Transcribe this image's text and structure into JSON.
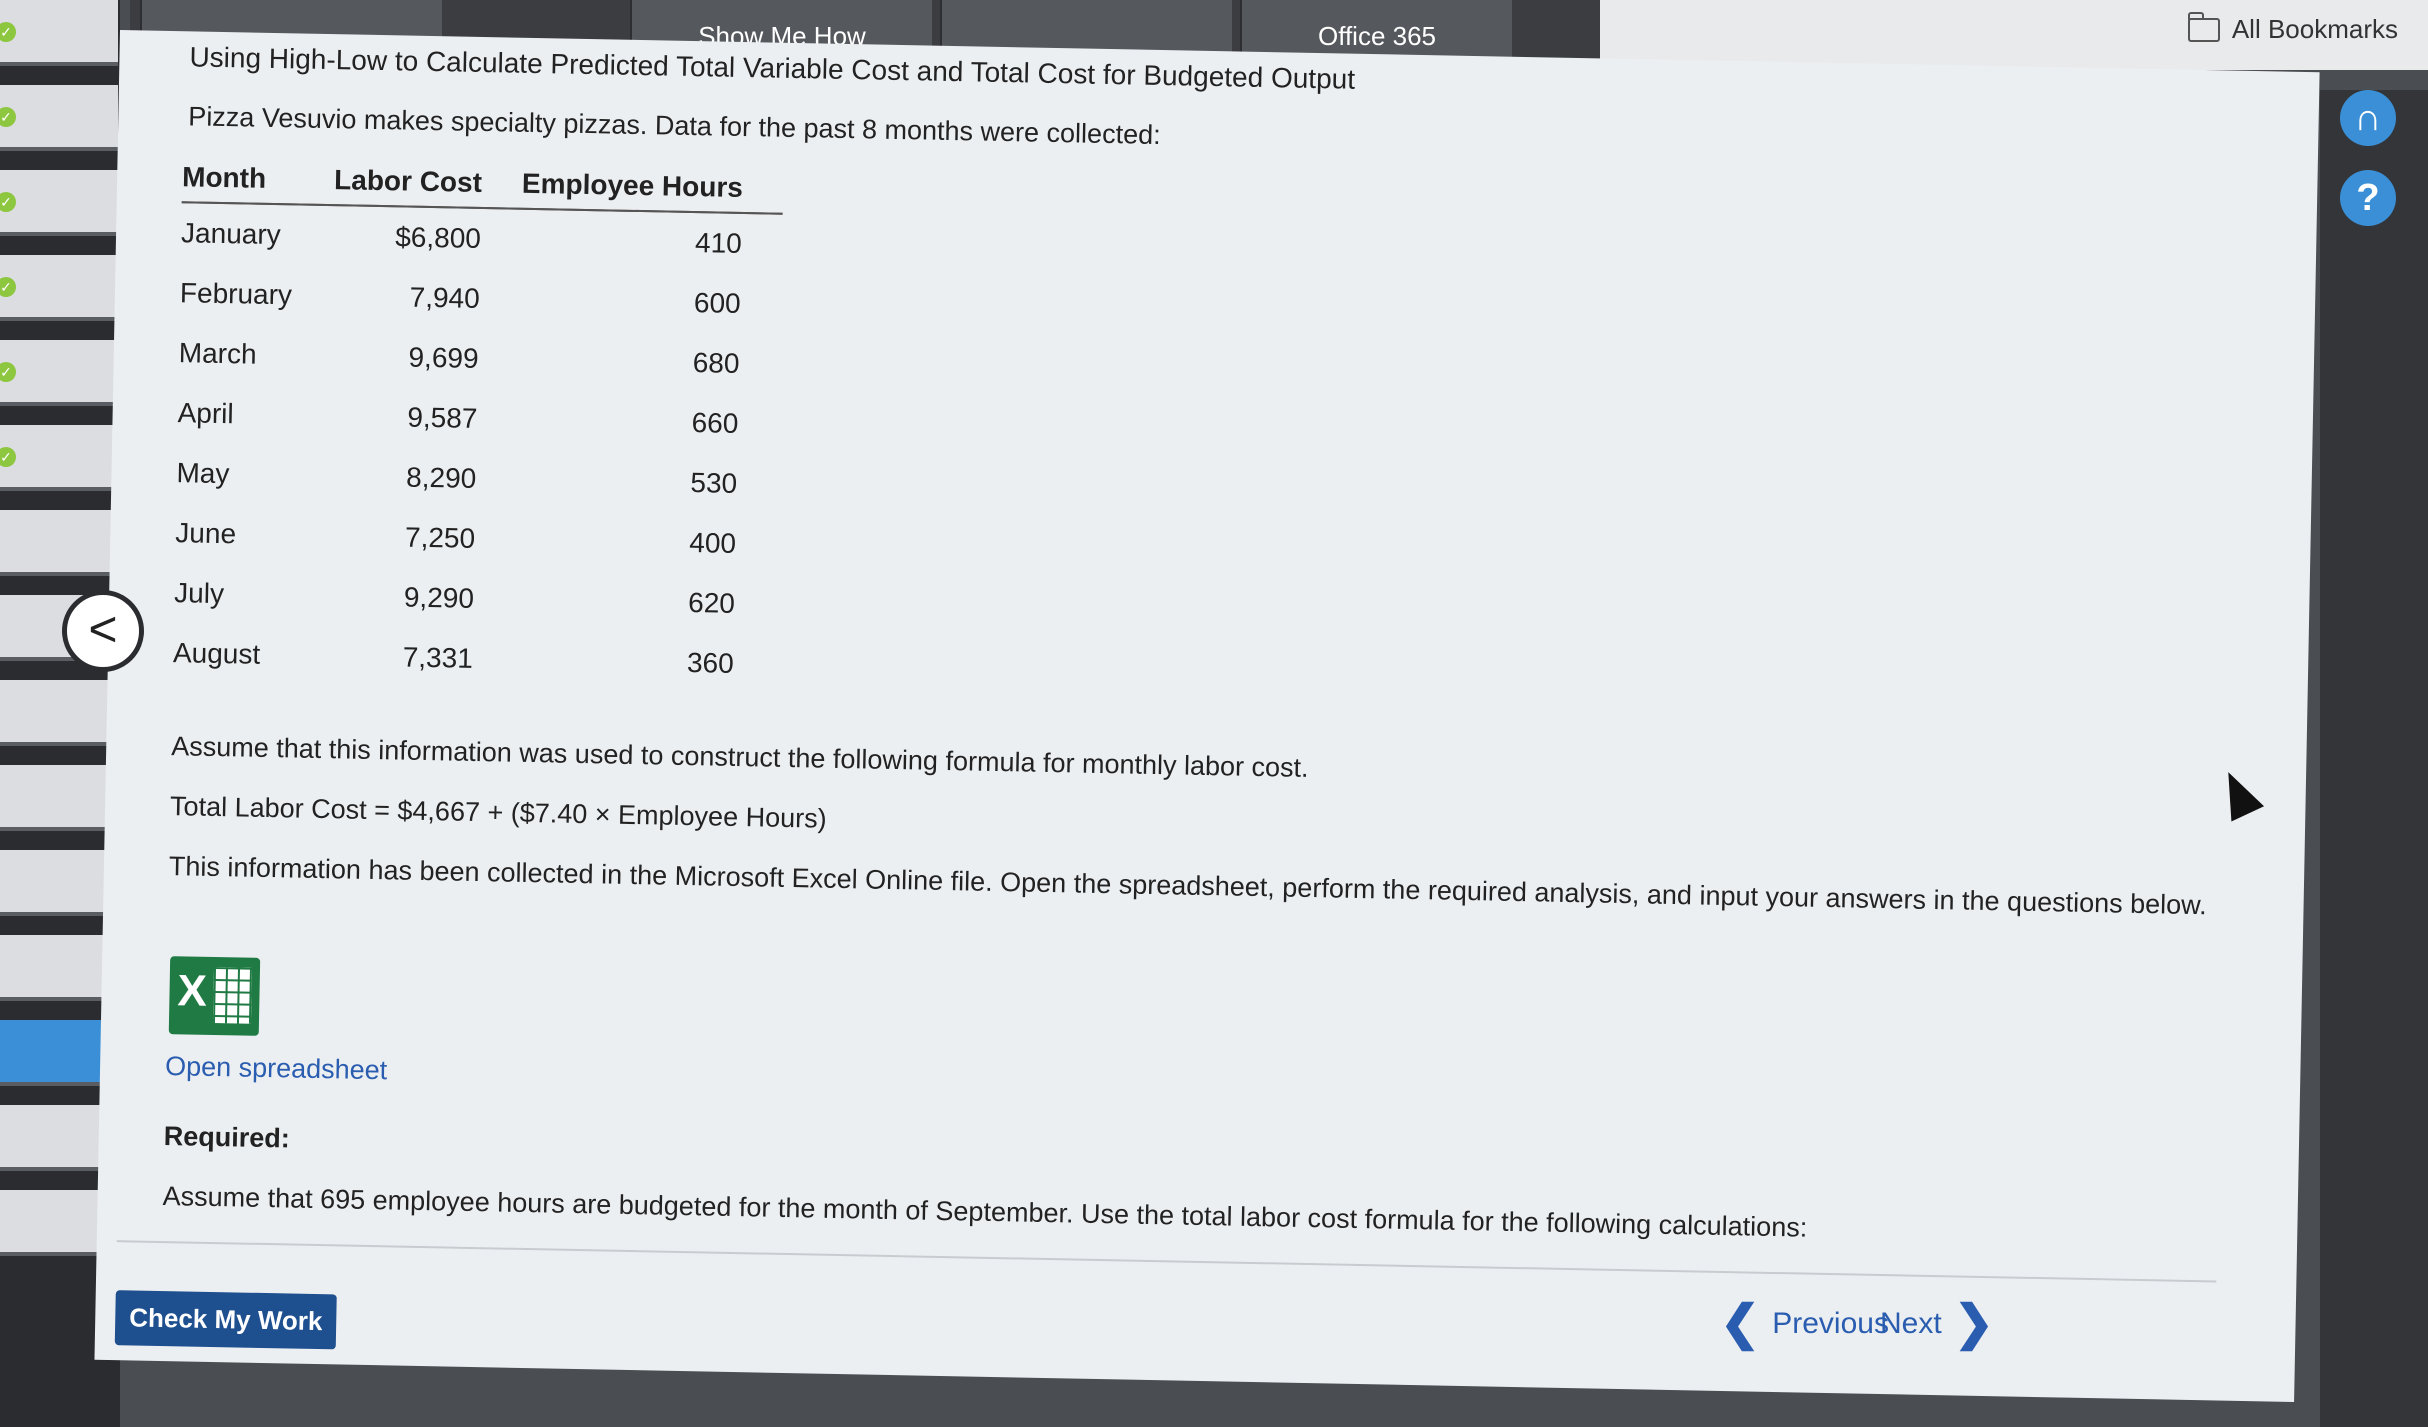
{
  "toolbar": {
    "tabs": [
      "Show Me How",
      "Office 365"
    ]
  },
  "bookmarks": {
    "label": "All Bookmarks"
  },
  "title": "Using High-Low to Calculate Predicted Total Variable Cost and Total Cost for Budgeted Output",
  "intro": "Pizza Vesuvio makes specialty pizzas. Data for the past 8 months were collected:",
  "table": {
    "headers": [
      "Month",
      "Labor Cost",
      "Employee Hours"
    ],
    "rows": [
      [
        "January",
        "$6,800",
        "410"
      ],
      [
        "February",
        "7,940",
        "600"
      ],
      [
        "March",
        "9,699",
        "680"
      ],
      [
        "April",
        "9,587",
        "660"
      ],
      [
        "May",
        "8,290",
        "530"
      ],
      [
        "June",
        "7,250",
        "400"
      ],
      [
        "July",
        "9,290",
        "620"
      ],
      [
        "August",
        "7,331",
        "360"
      ]
    ]
  },
  "para1": "Assume that this information was used to construct the following formula for monthly labor cost.",
  "formula": "Total Labor Cost = $4,667 + ($7.40 × Employee Hours)",
  "para2": "This information has been collected in the Microsoft Excel Online file. Open the spreadsheet, perform the required analysis, and input your answers in the questions below.",
  "open_link": "Open spreadsheet",
  "required_label": "Required:",
  "assumption": "Assume that 695 employee hours are budgeted for the month of September. Use the total labor cost formula for the following calculations:",
  "buttons": {
    "check": "Check My Work",
    "previous": "Previous",
    "next": "Next"
  },
  "icons": {
    "back": "chevron-left-icon",
    "headset": "headset-icon",
    "help": "help-icon",
    "excel": "excel-icon"
  }
}
